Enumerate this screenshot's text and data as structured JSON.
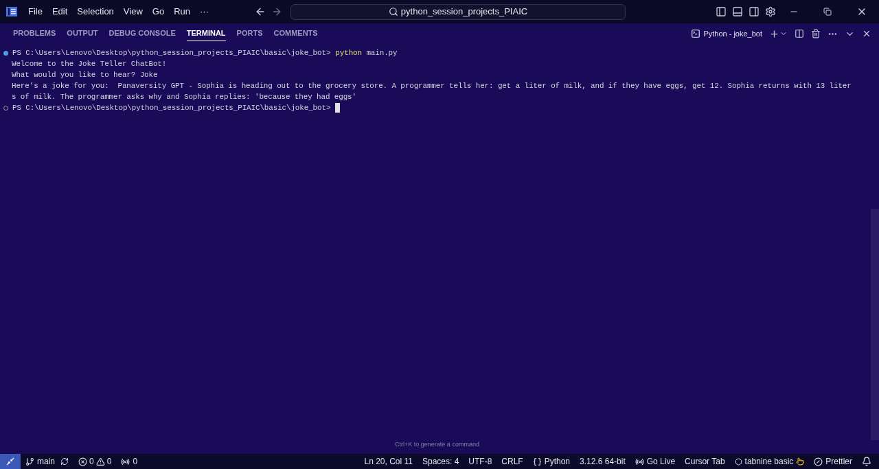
{
  "menu": [
    "File",
    "Edit",
    "Selection",
    "View",
    "Go",
    "Run",
    "···"
  ],
  "search": {
    "value": "python_session_projects_PIAIC"
  },
  "panel_tabs": [
    {
      "label": "PROBLEMS",
      "selected": false
    },
    {
      "label": "OUTPUT",
      "selected": false
    },
    {
      "label": "DEBUG CONSOLE",
      "selected": false
    },
    {
      "label": "TERMINAL",
      "selected": true
    },
    {
      "label": "PORTS",
      "selected": false
    },
    {
      "label": "COMMENTS",
      "selected": false
    }
  ],
  "terminal_name": "Python - joke_bot",
  "terminal_lines": [
    {
      "kind": "prompt",
      "done": true,
      "path": "PS C:\\Users\\Lenovo\\Desktop\\python_session_projects_PIAIC\\basic\\joke_bot>",
      "program": "python",
      "args": "main.py"
    },
    {
      "kind": "output",
      "text": "Welcome to the Joke Teller ChatBot!"
    },
    {
      "kind": "output",
      "text": "What would you like to hear? Joke"
    },
    {
      "kind": "output",
      "text": "Here's a joke for you:  Panaversity GPT - Sophia is heading out to the grocery store. A programmer tells her: get a liter of milk, and if they have eggs, get 12. Sophia returns with 13 liter"
    },
    {
      "kind": "output",
      "text": "s of milk. The programmer asks why and Sophia replies: 'because they had eggs'"
    },
    {
      "kind": "prompt",
      "done": false,
      "path": "PS C:\\Users\\Lenovo\\Desktop\\python_session_projects_PIAIC\\basic\\joke_bot>",
      "cursor": true
    }
  ],
  "hint": "Ctrl+K to generate a command",
  "status_left": {
    "branch": "main",
    "errors": "0",
    "warnings": "0",
    "ports": "0"
  },
  "status_right": [
    {
      "kind": "text",
      "text": "Ln 20, Col 11"
    },
    {
      "kind": "text",
      "text": "Spaces: 4"
    },
    {
      "kind": "text",
      "text": "UTF-8"
    },
    {
      "kind": "text",
      "text": "CRLF"
    },
    {
      "kind": "language",
      "text": "Python"
    },
    {
      "kind": "text",
      "text": "3.12.6 64-bit"
    },
    {
      "kind": "golive",
      "text": "Go Live"
    },
    {
      "kind": "text",
      "text": "Cursor Tab"
    },
    {
      "kind": "tabnine",
      "text": "tabnine basic"
    },
    {
      "kind": "prettier",
      "text": "Prettier"
    },
    {
      "kind": "bell"
    }
  ]
}
